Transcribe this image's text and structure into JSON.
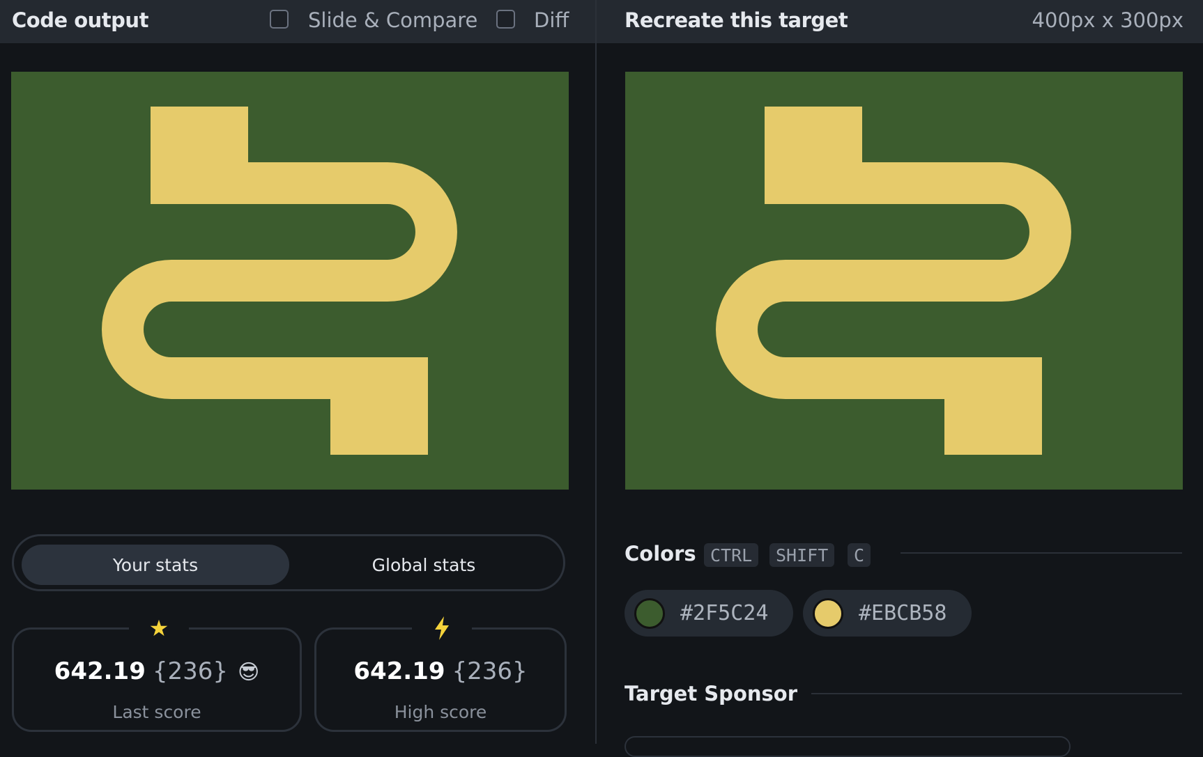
{
  "left_panel": {
    "title": "Code output",
    "slide_compare_label": "Slide & Compare",
    "diff_label": "Diff"
  },
  "right_panel": {
    "title": "Recreate this target",
    "dimensions": "400px x 300px"
  },
  "stats": {
    "tabs": {
      "your": "Your stats",
      "global": "Global stats"
    },
    "last": {
      "icon": "star-icon",
      "value": "642.19",
      "count": "{236}",
      "emoji": "😎",
      "label": "Last score"
    },
    "high": {
      "icon": "lightning-icon",
      "value": "642.19",
      "count": "{236}",
      "label": "High score"
    }
  },
  "colors": {
    "title": "Colors",
    "shortcut": [
      "CTRL",
      "SHIFT",
      "C"
    ],
    "swatches": [
      {
        "hex": "#2F5C24",
        "color": "#3c5c2e"
      },
      {
        "hex": "#EBCB58",
        "color": "#e6cb6b"
      }
    ]
  },
  "sponsor": {
    "title": "Target Sponsor"
  },
  "palette": {
    "canvas_bg": "#3c5c2e",
    "shape": "#e6cb6b"
  }
}
